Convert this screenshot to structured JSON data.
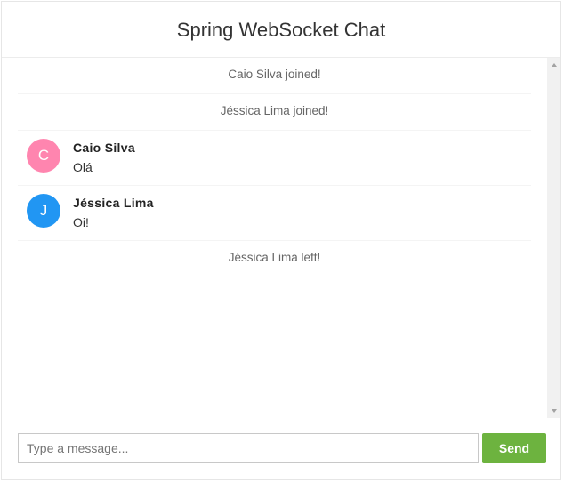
{
  "header": {
    "title": "Spring WebSocket Chat"
  },
  "messages": {
    "event_1": "Caio Silva joined!",
    "event_2": "Jéssica Lima joined!",
    "chat_1": {
      "initial": "C",
      "sender": "Caio Silva",
      "text": "Olá",
      "avatar_color": "#ff85af"
    },
    "chat_2": {
      "initial": "J",
      "sender": "Jéssica Lima",
      "text": "Oi!",
      "avatar_color": "#2196f3"
    },
    "event_3": "Jéssica Lima left!"
  },
  "form": {
    "placeholder": "Type a message...",
    "send_label": "Send",
    "send_color": "#6db33f"
  }
}
